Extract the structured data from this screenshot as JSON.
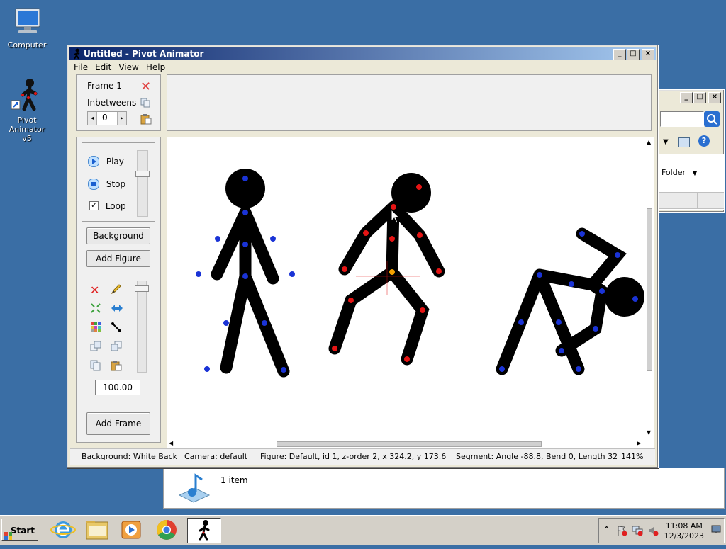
{
  "desktop": {
    "icons": [
      {
        "label": "Computer"
      },
      {
        "label": "Pivot Animator\nv5"
      }
    ]
  },
  "window": {
    "title": "Untitled - Pivot Animator",
    "menu": [
      "File",
      "Edit",
      "View",
      "Help"
    ]
  },
  "frame_panel": {
    "frame_label": "Frame 1",
    "inbetweens_label": "Inbetweens",
    "inbetweens_value": "0"
  },
  "playback": {
    "play": "Play",
    "stop": "Stop",
    "loop": "Loop",
    "loop_checked": true
  },
  "buttons": {
    "background": "Background",
    "add_figure": "Add Figure",
    "add_frame": "Add Frame"
  },
  "figure_tools": {
    "scale_value": "100.00"
  },
  "statusbar": {
    "background": "Background: White Back",
    "camera": "Camera: default",
    "figure": "Figure: Default,  id 1,  z-order 2,  x 324.2, y 173.6",
    "segment": "Segment: Angle -88.8,  Bend 0,  Length 32",
    "zoom": "141%"
  },
  "explorer": {
    "folder_label": "Folder",
    "item_count": "1 item"
  },
  "taskbar": {
    "start": "Start",
    "time": "11:08 AM",
    "date": "12/3/2023"
  },
  "colors": {
    "desktop": "#3a6ea5",
    "joint_blue": "#1a33d6",
    "joint_red": "#e51414",
    "joint_orange": "#f2a000",
    "figure": "#000000"
  }
}
